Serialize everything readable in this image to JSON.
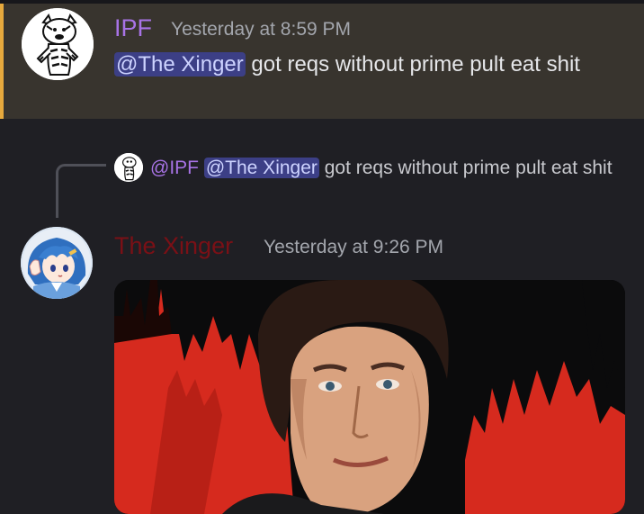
{
  "messages": [
    {
      "author": "IPF",
      "timestamp": "Yesterday at 8:59 PM",
      "mention": "@The Xinger",
      "text": " got reqs without prime pult eat shit",
      "author_color": "#a873e6",
      "highlighted": true,
      "highlight_color": "#e6a93d",
      "avatar_icon": "cartoon-tiger-avatar-icon"
    },
    {
      "author": "The Xinger",
      "timestamp": "Yesterday at 9:26 PM",
      "author_color": "#7a1016",
      "avatar_icon": "anime-girl-avatar-icon",
      "reply": {
        "author": "@IPF",
        "mention": "@The Xinger",
        "text": " got reqs without prime pult eat shit",
        "avatar_icon": "cartoon-tiger-avatar-icon"
      },
      "attachment": {
        "type": "image",
        "icon": "man-red-background-image"
      }
    }
  ]
}
